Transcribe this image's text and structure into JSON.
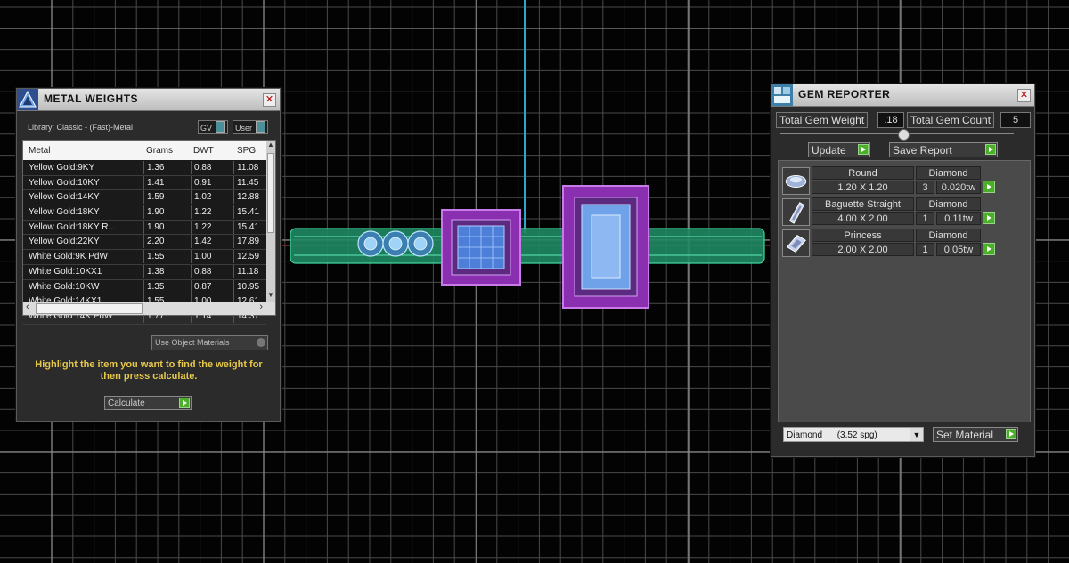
{
  "metal_weights": {
    "title": "METAL WEIGHTS",
    "library_label": "Library: Classic - (Fast)-Metal",
    "gv_label": "GV",
    "user_label": "User",
    "columns": [
      "Metal",
      "Grams",
      "DWT",
      "SPG"
    ],
    "rows": [
      [
        "Yellow Gold:9KY",
        "1.36",
        "0.88",
        "11.08"
      ],
      [
        "Yellow Gold:10KY",
        "1.41",
        "0.91",
        "11.45"
      ],
      [
        "Yellow Gold:14KY",
        "1.59",
        "1.02",
        "12.88"
      ],
      [
        "Yellow Gold:18KY",
        "1.90",
        "1.22",
        "15.41"
      ],
      [
        "Yellow Gold:18KY R...",
        "1.90",
        "1.22",
        "15.41"
      ],
      [
        "Yellow Gold:22KY",
        "2.20",
        "1.42",
        "17.89"
      ],
      [
        "White Gold:9K PdW",
        "1.55",
        "1.00",
        "12.59"
      ],
      [
        "White Gold:10KX1",
        "1.38",
        "0.88",
        "11.18"
      ],
      [
        "White Gold:10KW",
        "1.35",
        "0.87",
        "10.95"
      ],
      [
        "White Gold:14KX1",
        "1.55",
        "1.00",
        "12.61"
      ],
      [
        "White Gold:14K PdW",
        "1.77",
        "1.14",
        "14.37"
      ]
    ],
    "use_object_materials": "Use Object Materials",
    "hint": "Highlight the item you want to find the weight for then press calculate.",
    "calculate_label": "Calculate"
  },
  "gem_reporter": {
    "title": "GEM REPORTER",
    "total_weight_label": "Total Gem Weight",
    "total_weight": ".18",
    "total_count_label": "Total Gem Count",
    "total_count": "5",
    "update_label": "Update",
    "save_report_label": "Save Report",
    "gems": [
      {
        "shape": "Round",
        "material": "Diamond",
        "size": "1.20 X 1.20",
        "count": "3",
        "weight": "0.020tw",
        "icon": "round-gem-icon"
      },
      {
        "shape": "Baguette Straight",
        "material": "Diamond",
        "size": "4.00 X 2.00",
        "count": "1",
        "weight": "0.11tw",
        "icon": "baguette-gem-icon"
      },
      {
        "shape": "Princess",
        "material": "Diamond",
        "size": "2.00 X 2.00",
        "count": "1",
        "weight": "0.05tw",
        "icon": "princess-gem-icon"
      }
    ],
    "material_select": "Diamond      (3.52 spg)",
    "set_material_label": "Set Material"
  },
  "colors": {
    "background": "#030303",
    "grid": "#4a4a4a",
    "axis_cyan": "#29a9c9",
    "band": "#1f8a63",
    "bezel": "#8a2fb0",
    "hint_yellow": "#e6c84a",
    "go_green": "#4caf2a"
  }
}
